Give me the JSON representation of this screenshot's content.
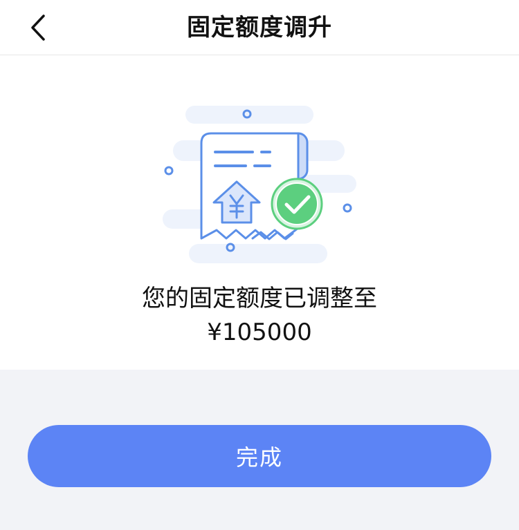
{
  "nav": {
    "title": "固定额度调升",
    "back_icon": "chevron-left-icon"
  },
  "result": {
    "message": "您的固定额度已调整至",
    "amount": "¥105000",
    "illustration_icon": "receipt-approved-icon",
    "currency_symbol": "¥"
  },
  "actions": {
    "done_label": "完成"
  },
  "colors": {
    "primary": "#5c84f5",
    "success": "#5ccf7f",
    "illustration_blue": "#5b8fe8",
    "background": "#f2f3f7"
  }
}
